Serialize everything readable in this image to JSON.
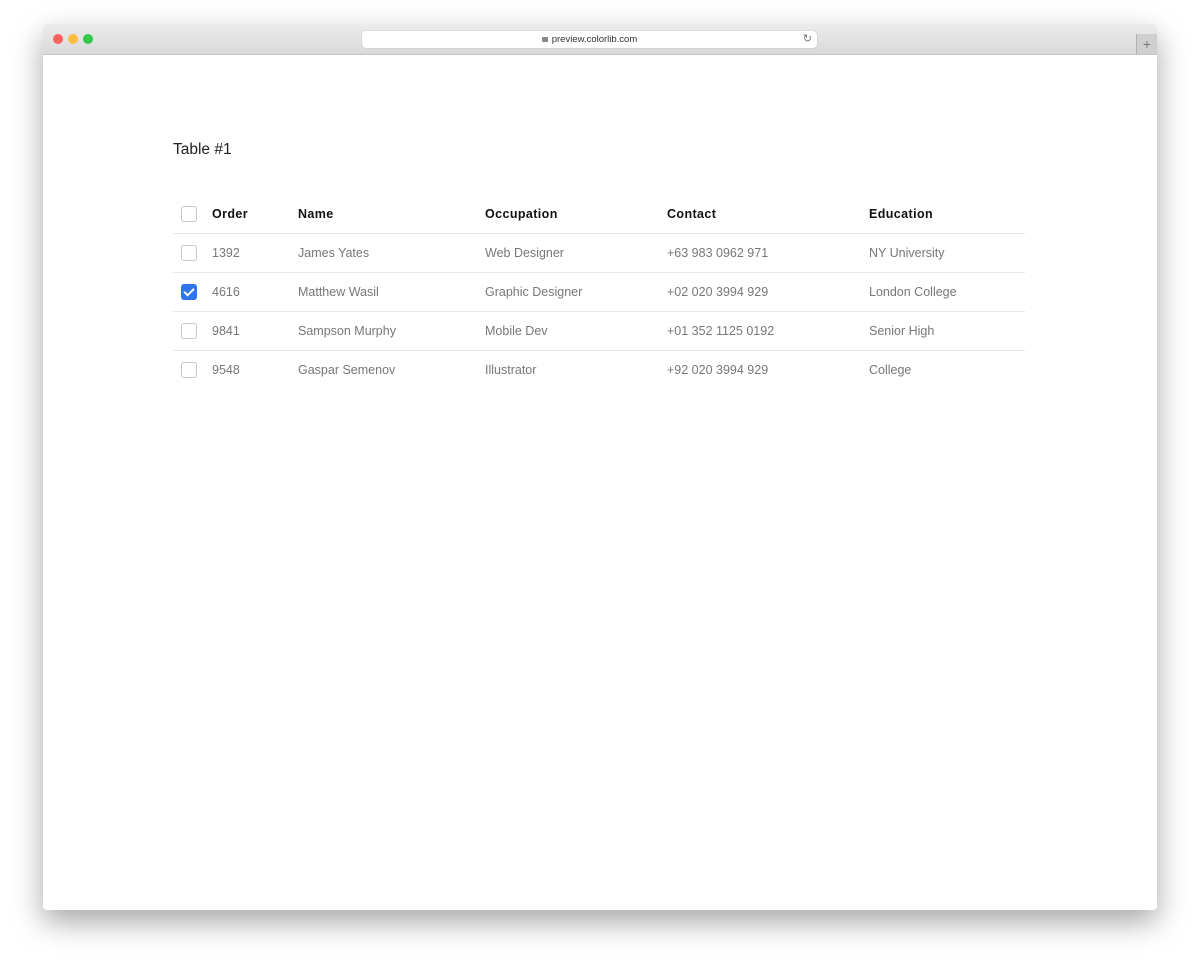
{
  "browser": {
    "url": "preview.colorlib.com",
    "new_tab": "+"
  },
  "page": {
    "title": "Table #1"
  },
  "table": {
    "headers": [
      "Order",
      "Name",
      "Occupation",
      "Contact",
      "Education"
    ],
    "rows": [
      {
        "checked": false,
        "cells": [
          "1392",
          "James Yates",
          "Web Designer",
          "+63 983 0962 971",
          "NY University"
        ]
      },
      {
        "checked": true,
        "cells": [
          "4616",
          "Matthew Wasil",
          "Graphic Designer",
          "+02 020 3994 929",
          "London College"
        ]
      },
      {
        "checked": false,
        "cells": [
          "9841",
          "Sampson Murphy",
          "Mobile Dev",
          "+01 352 1125 0192",
          "Senior High"
        ]
      },
      {
        "checked": false,
        "cells": [
          "9548",
          "Gaspar Semenov",
          "Illustrator",
          "+92 020 3994 929",
          "College"
        ]
      }
    ]
  },
  "colors": {
    "accent": "#2f74e8"
  }
}
